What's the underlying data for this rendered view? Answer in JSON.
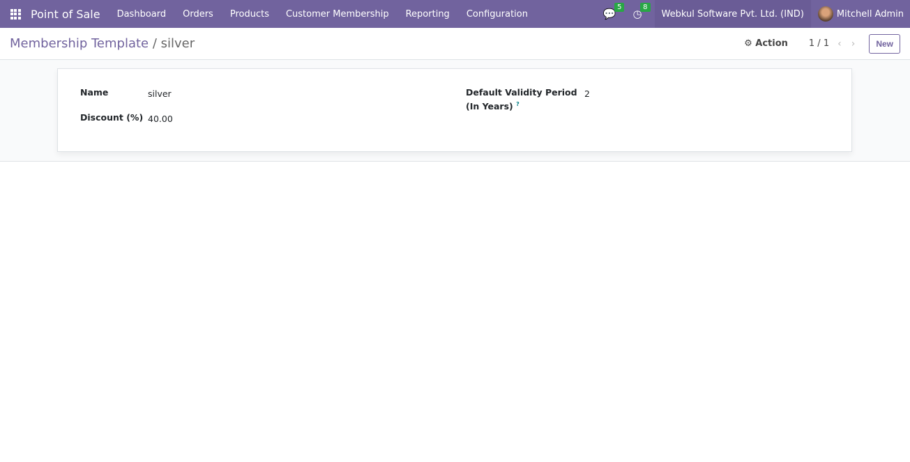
{
  "nav": {
    "brand": "Point of Sale",
    "menu": [
      "Dashboard",
      "Orders",
      "Products",
      "Customer Membership",
      "Reporting",
      "Configuration"
    ],
    "messages_count": "5",
    "activities_count": "8",
    "company": "Webkul Software Pvt. Ltd. (IND)",
    "user": "Mitchell Admin"
  },
  "control": {
    "breadcrumb_parent": "Membership Template",
    "breadcrumb_current": "silver",
    "action_label": "Action",
    "pager": "1 / 1",
    "new_label": "New"
  },
  "form": {
    "name_label": "Name",
    "name_value": "silver",
    "discount_label": "Discount (%)",
    "discount_value": "40.00",
    "validity_label_1": "Default Validity Period",
    "validity_label_2": "(In Years)",
    "help_mark": "?",
    "validity_value": "2"
  }
}
